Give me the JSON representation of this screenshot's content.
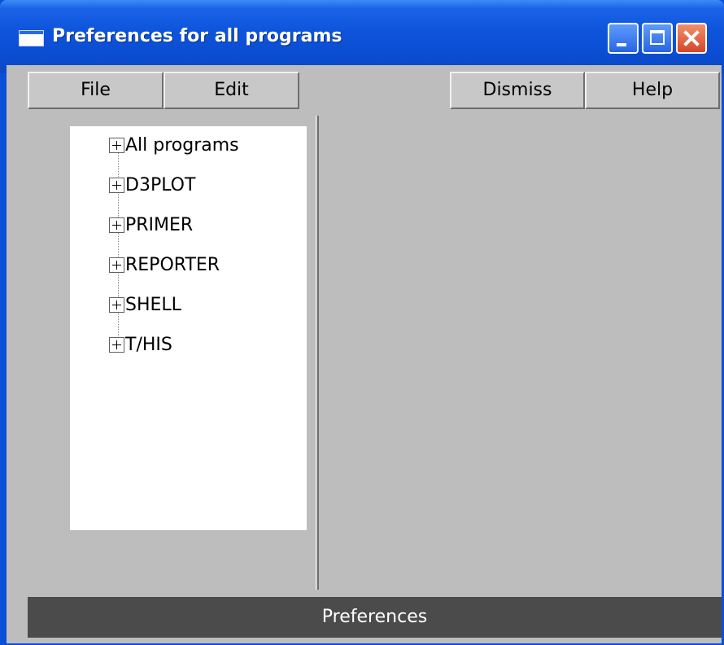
{
  "window": {
    "title": "Preferences for all programs"
  },
  "menu": {
    "file_label": "File",
    "edit_label": "Edit",
    "dismiss_label": "Dismiss",
    "help_label": "Help"
  },
  "tree": {
    "items": [
      {
        "label": "All programs",
        "icon": "expand-plus-icon"
      },
      {
        "label": "D3PLOT",
        "icon": "expand-plus-icon"
      },
      {
        "label": "PRIMER",
        "icon": "expand-plus-icon"
      },
      {
        "label": "REPORTER",
        "icon": "expand-plus-icon"
      },
      {
        "label": "SHELL",
        "icon": "expand-plus-icon"
      },
      {
        "label": "T/HIS",
        "icon": "expand-plus-icon"
      }
    ]
  },
  "status": {
    "text": "Preferences"
  },
  "colors": {
    "titlebar": "#0b4ed3",
    "client_bg": "#bdbdbd",
    "status_bg": "#4b4b4b",
    "close_button": "#d6462a"
  },
  "icons": {
    "app": "window-icon",
    "minimize": "minimize-icon",
    "maximize": "maximize-icon",
    "close": "close-icon"
  }
}
